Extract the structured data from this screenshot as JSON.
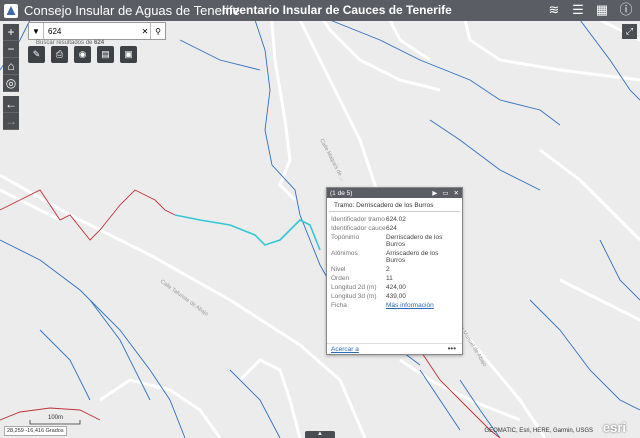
{
  "header": {
    "org_title": "Consejo Insular de Aguas de Tenerife",
    "app_title": "Inventario Insular de Cauces de Tenerife"
  },
  "search": {
    "value": "624",
    "hint_prefix": "Buscar resultados de",
    "hint_term": "624"
  },
  "map": {
    "road_labels": [
      "Calle Malpaís de ...",
      "Calle Tafuriste de Abajo",
      "Calle Manuel de Abajo"
    ],
    "scale_label": "100m",
    "coords": "28,259 -16,416 Grados",
    "attribution": "GEOMATIC, Esri, HERE, Garmin, USGS",
    "esri_logo": "esri",
    "colors": {
      "river_blue": "#2f6fc0",
      "segment_red": "#c0303a",
      "selected_cyan": "#33c7d8",
      "road": "#ffffff",
      "background": "#ececec"
    }
  },
  "popup": {
    "counter": "(1 de 5)",
    "title": "Tramo: Derriscadero de los Burros",
    "rows": [
      {
        "key": "Identificador tramo",
        "value": "624.02"
      },
      {
        "key": "Identificador cauce",
        "value": "624"
      },
      {
        "key": "Topónimo",
        "value": "Derriscadero de los Burros"
      },
      {
        "key": "Alónimos",
        "value": "Arriscadero de los Burros"
      },
      {
        "key": "Nivel",
        "value": "2"
      },
      {
        "key": "Orden",
        "value": "11"
      },
      {
        "key": "Longitud 2d (m)",
        "value": "424,00"
      },
      {
        "key": "Longitud 3d (m)",
        "value": "439,00"
      }
    ],
    "link_row": {
      "key": "Ficha",
      "value": "Más información"
    },
    "zoom_label": "Acercar a",
    "more_label": "•••"
  }
}
